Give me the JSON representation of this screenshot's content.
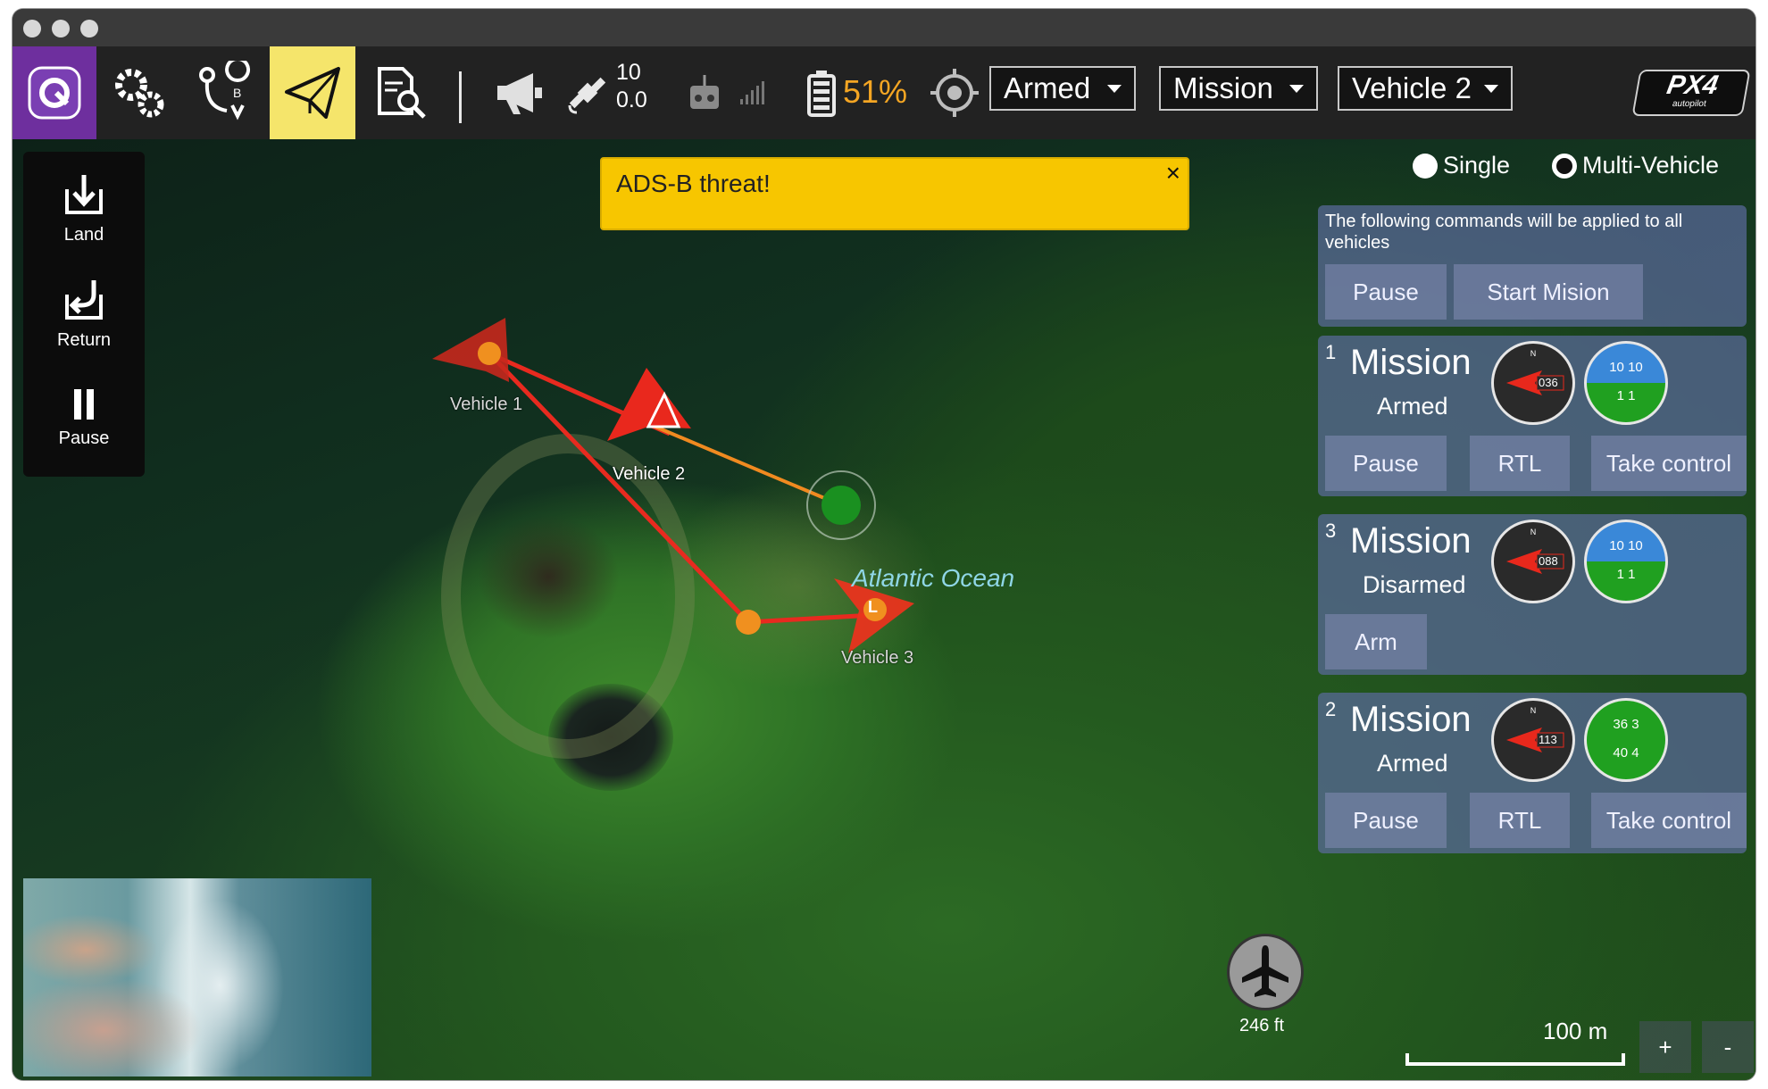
{
  "toolbar": {
    "app_icon": "qgc-logo-icon",
    "items": [
      "settings-icon",
      "plan-icon",
      "fly-icon",
      "analyze-icon"
    ],
    "gps": {
      "satellites": "10",
      "hdop": "0.0"
    },
    "battery": "51%",
    "flight_mode_dropdown": "Armed",
    "mode_dropdown": "Mission",
    "vehicle_dropdown": "Vehicle 2",
    "brand": "PX4 autopilot",
    "accent": "#f5e56b",
    "battery_color": "#f5a623"
  },
  "left_panel": {
    "items": [
      {
        "label": "Land",
        "icon": "land-icon"
      },
      {
        "label": "Return",
        "icon": "return-icon"
      },
      {
        "label": "Pause",
        "icon": "pause-icon"
      }
    ]
  },
  "alert": {
    "text": "ADS-B threat!",
    "close": "×"
  },
  "vehicle_mode": {
    "single": "Single",
    "multi": "Multi-Vehicle"
  },
  "multi_vehicle": {
    "note": "The following commands will be applied to all vehicles",
    "pause": "Pause",
    "start_mission": "Start Mision",
    "vehicles": [
      {
        "id": "1",
        "mode": "Mission",
        "status": "Armed",
        "heading": "036",
        "alt_top": "10",
        "alt_bottom": "1",
        "attitude_alt": "10 10",
        "attitude_speed": "1 1",
        "buttons": [
          "Pause",
          "RTL",
          "Take control"
        ]
      },
      {
        "id": "3",
        "mode": "Mission",
        "status": "Disarmed",
        "heading": "088",
        "attitude_alt": "10 10",
        "attitude_speed": "1 1",
        "buttons": [
          "Arm"
        ]
      },
      {
        "id": "2",
        "mode": "Mission",
        "status": "Armed",
        "heading": "113",
        "attitude_alt": "36 3",
        "attitude_speed": "40 4",
        "buttons": [
          "Pause",
          "RTL",
          "Take control"
        ]
      }
    ]
  },
  "map": {
    "labels": {
      "vehicle1": "Vehicle 1",
      "vehicle2": "Vehicle 2",
      "vehicle3": "Vehicle 3",
      "ocean": "Atlantic Ocean",
      "launch": "L"
    },
    "adsb": {
      "altitude": "246 ft",
      "icon": "airplane-icon"
    },
    "scale": "100 m",
    "zoom_in": "+",
    "zoom_out": "-"
  }
}
